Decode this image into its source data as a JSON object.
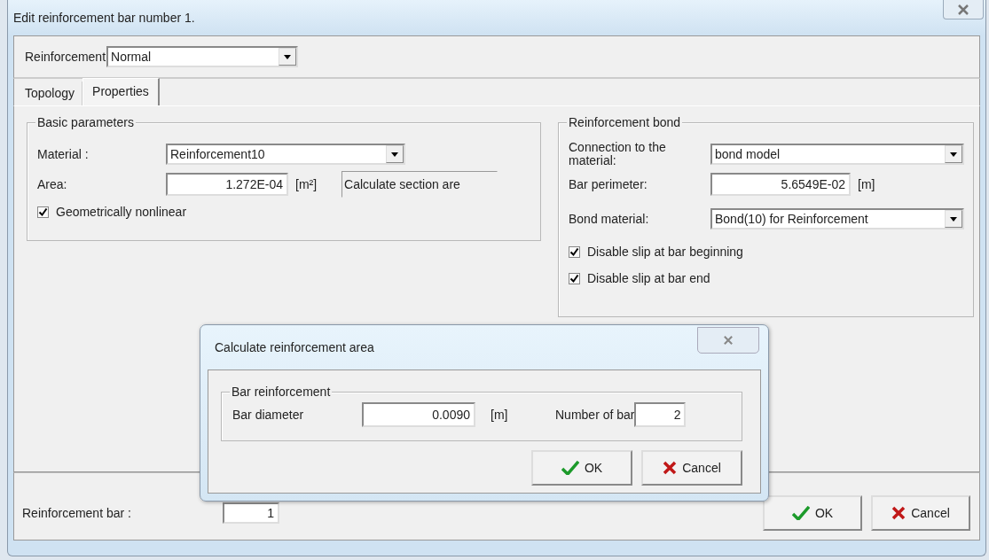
{
  "window": {
    "title": "Edit reinforcement bar number 1."
  },
  "reinforcement": {
    "label": "Reinforcement",
    "value": "Normal"
  },
  "tabs": [
    {
      "label": "Topology",
      "selected": false
    },
    {
      "label": "Properties",
      "selected": true
    }
  ],
  "basic_parameters": {
    "title": "Basic parameters",
    "material": {
      "label": "Material :",
      "value": "Reinforcement10"
    },
    "area": {
      "label": "Area:",
      "value": "1.272E-04",
      "unit": "[m²]"
    },
    "calculate_button": "Calculate section are",
    "geometrically_nonlinear": {
      "label": "Geometrically nonlinear",
      "checked": true
    }
  },
  "reinforcement_bond": {
    "title": "Reinforcement bond",
    "connection": {
      "label": "Connection to the material:",
      "value": "bond model"
    },
    "bar_perimeter": {
      "label": "Bar perimeter:",
      "value": "5.6549E-02",
      "unit": "[m]"
    },
    "bond_material": {
      "label": "Bond material:",
      "value": "Bond(10) for Reinforcement"
    },
    "options": [
      {
        "label": "Disable slip at bar beginning",
        "checked": true
      },
      {
        "label": "Disable slip at bar end",
        "checked": true
      }
    ]
  },
  "bottom": {
    "label": "Reinforcement bar :",
    "value": "1",
    "ok": "OK",
    "cancel": "Cancel"
  },
  "dialog": {
    "title": "Calculate reinforcement area",
    "group": "Bar reinforcement",
    "diameter": {
      "label": "Bar diameter",
      "value": "0.0090",
      "unit": "[m]"
    },
    "number": {
      "label": "Number of bar",
      "value": "2"
    },
    "ok": "OK",
    "cancel": "Cancel"
  }
}
